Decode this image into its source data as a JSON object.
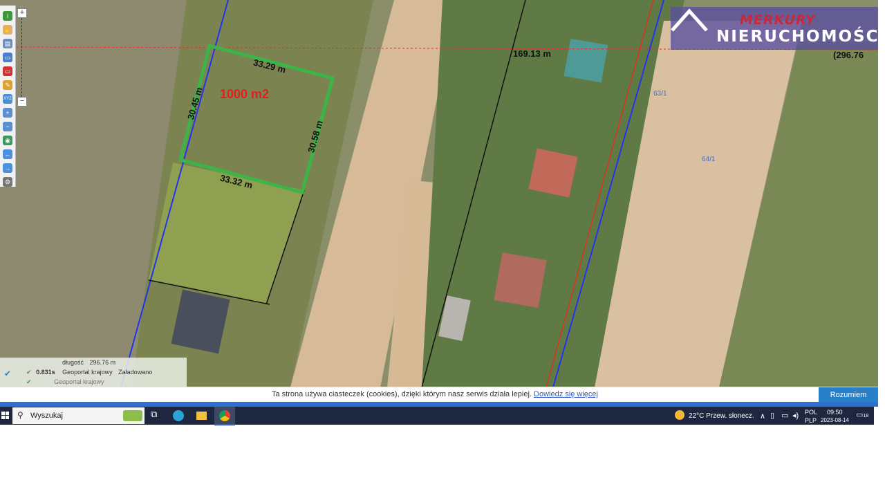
{
  "map": {
    "plot_area_label": "1000 m2",
    "dimensions": [
      "33.29 m",
      "30.45 m",
      "30.58 m",
      "33.32 m"
    ],
    "road_length": "169.13 m",
    "total_length": "(296.76",
    "parcel_labels": [
      "64/1",
      "63/1"
    ]
  },
  "brand": {
    "line1": "MERKURY",
    "line2": "NIERUCHOMOŚCI"
  },
  "status_panel": {
    "measure_label": "długość",
    "measure_value": "296.76 m",
    "time_value": "0.831s",
    "service_name": "Geoportal krajowy",
    "service_status": "Załadowano",
    "row3": "Geoportal krajowy"
  },
  "cookie_bar": {
    "message": "Ta strona używa ciasteczek (cookies), dzięki którym nasz serwis działa lepiej.",
    "link": "Dowiedz się więcej",
    "accept": "Rozumiem"
  },
  "taskbar": {
    "search_placeholder": "Wyszukaj",
    "weather": "22°C  Przew. słonecz.",
    "lang1": "POL",
    "lang2": "PLP",
    "time": "09:50",
    "date": "2023-08-14",
    "notifications": "18"
  },
  "colors": {
    "plot_outline": "#3cb447",
    "area_label": "#e02020",
    "cookie_button": "#2a7fc9",
    "taskbar": "#1d2840"
  }
}
